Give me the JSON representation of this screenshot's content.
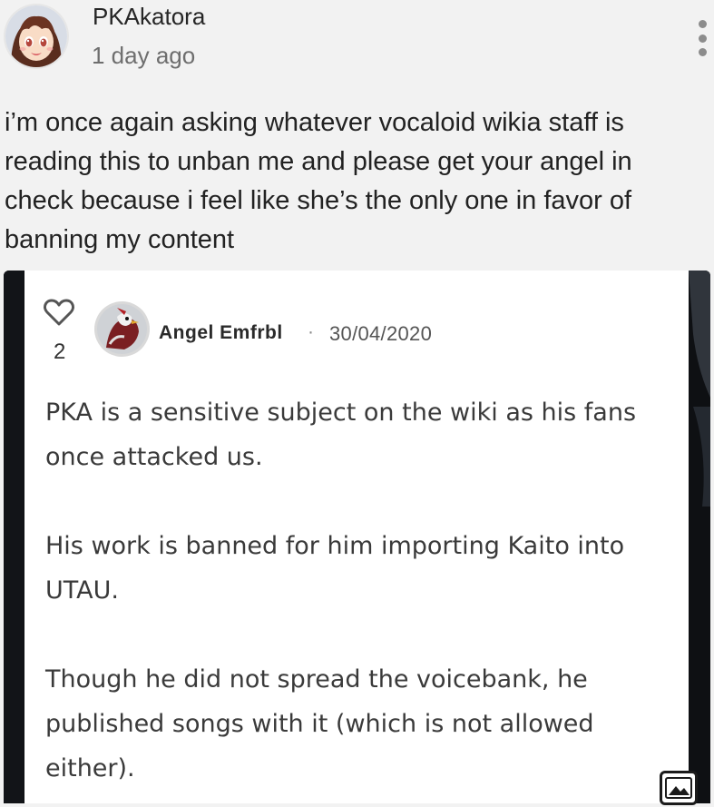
{
  "post": {
    "username": "PKAkatora",
    "time_ago": "1 day ago",
    "body": "i’m once again asking whatever vocaloid wikia staff is reading this to unban me and please get your angel in check because i feel like she’s the only one in favor of banning my content"
  },
  "embedded_comment": {
    "likes": "2",
    "author": "Angel Emfrbl",
    "separator": "·",
    "date": "30/04/2020",
    "paragraphs": [
      "PKA is a sensitive subject on the wiki as his fans once attacked us.",
      "His work is banned for him importing Kaito into UTAU.",
      "Though he did not spread the voicebank, he published songs with it (which is not allowed either)."
    ]
  },
  "icons": {
    "menu": "more-vertical-icon",
    "like": "heart-icon",
    "image": "image-icon"
  },
  "colors": {
    "page_background": "#f2f2f2",
    "embed_frame": "#0f1114",
    "card_background": "#ffffff"
  }
}
